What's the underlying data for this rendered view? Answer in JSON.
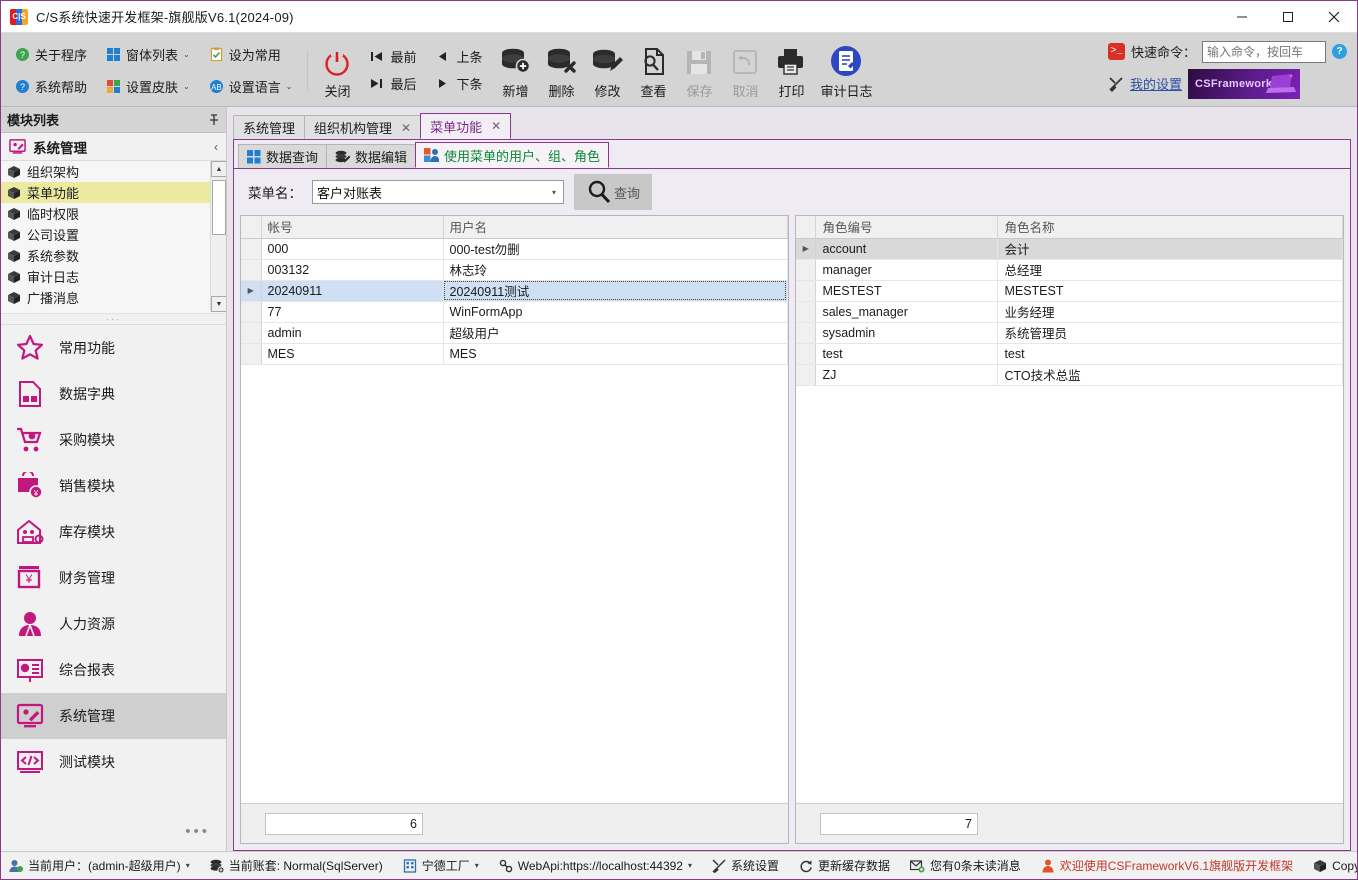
{
  "window": {
    "title": "C/S系统快速开发框架-旗舰版V6.1(2024-09)",
    "logo_text": "C|S",
    "minimize": "—",
    "maximize": "□",
    "close": "✕"
  },
  "ribbon": {
    "small_items": [
      {
        "label": "关于程序",
        "icon": "help-green-icon",
        "caret": ""
      },
      {
        "label": "系统帮助",
        "icon": "help-blue-icon",
        "caret": ""
      },
      {
        "label": "窗体列表",
        "icon": "windows-tile-icon",
        "caret": "⌄"
      },
      {
        "label": "设置皮肤",
        "icon": "skin-palette-icon",
        "caret": "⌄"
      },
      {
        "label": "设为常用",
        "icon": "checklist-icon",
        "caret": ""
      },
      {
        "label": "设置语言",
        "icon": "language-ab-icon",
        "caret": "⌄"
      }
    ],
    "close_button": {
      "label": "关闭",
      "icon": "power-icon"
    },
    "nav": [
      {
        "label": "最前",
        "icon": "first-record-icon"
      },
      {
        "label": "最后",
        "icon": "last-record-icon"
      },
      {
        "label": "上条",
        "icon": "prev-record-icon"
      },
      {
        "label": "下条",
        "icon": "next-record-icon"
      }
    ],
    "big_buttons": [
      {
        "label": "新增",
        "icon": "db-add-icon",
        "disabled": false
      },
      {
        "label": "删除",
        "icon": "db-delete-icon",
        "disabled": false
      },
      {
        "label": "修改",
        "icon": "db-edit-icon",
        "disabled": false
      },
      {
        "label": "查看",
        "icon": "db-view-icon",
        "disabled": false
      },
      {
        "label": "保存",
        "icon": "save-icon",
        "disabled": true
      },
      {
        "label": "取消",
        "icon": "undo-icon",
        "disabled": true
      },
      {
        "label": "打印",
        "icon": "print-icon",
        "disabled": false
      },
      {
        "label": "审计日志",
        "icon": "audit-log-icon",
        "disabled": false
      }
    ],
    "quick_command": {
      "label": "快速命令：",
      "placeholder": "输入命令，按回车",
      "value": "",
      "icon": "console-icon",
      "help": "?"
    },
    "my_settings": {
      "label": "我的设置",
      "icon": "tools-icon"
    },
    "brand": {
      "text": "CSFramework",
      "icon": "laptop-icon"
    }
  },
  "sidebar": {
    "header": {
      "title": "模块列表",
      "pin_icon": "pin-icon"
    },
    "group": {
      "title": "系统管理",
      "icon": "system-manage-icon",
      "collapse_icon": "‹"
    },
    "tree_items": [
      {
        "label": "组织架构",
        "selected": false
      },
      {
        "label": "菜单功能",
        "selected": true
      },
      {
        "label": "临时权限",
        "selected": false
      },
      {
        "label": "公司设置",
        "selected": false
      },
      {
        "label": "系统参数",
        "selected": false
      },
      {
        "label": "审计日志",
        "selected": false
      },
      {
        "label": "广播消息",
        "selected": false
      }
    ],
    "tree_dots": "···",
    "modules": [
      {
        "label": "常用功能",
        "icon": "star-icon",
        "active": false
      },
      {
        "label": "数据字典",
        "icon": "dictionary-icon",
        "active": false
      },
      {
        "label": "采购模块",
        "icon": "cart-icon",
        "active": false
      },
      {
        "label": "销售模块",
        "icon": "sales-bag-icon",
        "active": false
      },
      {
        "label": "库存模块",
        "icon": "warehouse-icon",
        "active": false
      },
      {
        "label": "财务管理",
        "icon": "finance-yen-icon",
        "active": false
      },
      {
        "label": "人力资源",
        "icon": "person-icon",
        "active": false
      },
      {
        "label": "综合报表",
        "icon": "report-chart-icon",
        "active": false
      },
      {
        "label": "系统管理",
        "icon": "system-manage-icon",
        "active": true
      },
      {
        "label": "测试模块",
        "icon": "code-icon",
        "active": false
      }
    ],
    "footer_dots": "•••"
  },
  "main": {
    "doc_tabs": [
      {
        "label": "系统管理",
        "closable": false,
        "active": false
      },
      {
        "label": "组织机构管理",
        "closable": true,
        "active": false
      },
      {
        "label": "菜单功能",
        "closable": true,
        "active": true
      }
    ],
    "sub_tabs": [
      {
        "label": "数据查询",
        "icon": "windows-tile-icon",
        "active": false
      },
      {
        "label": "数据编辑",
        "icon": "edit-stack-icon",
        "active": false
      },
      {
        "label": "使用菜单的用户、组、角色",
        "icon": "users-icon",
        "active": true
      }
    ],
    "filter": {
      "label": "菜单名：",
      "combo_value": "客户对账表",
      "combo_caret": "▾",
      "query_button": {
        "label": "查询",
        "icon": "search-icon"
      }
    },
    "left_grid": {
      "columns": [
        "帐号",
        "用户名"
      ],
      "rows": [
        {
          "indicator": "",
          "cells": [
            "000",
            "000-test勿删"
          ],
          "selected": false
        },
        {
          "indicator": "",
          "cells": [
            "003132",
            "林志玲"
          ],
          "selected": false
        },
        {
          "indicator": "▶",
          "cells": [
            "20240911",
            "20240911测试"
          ],
          "selected": true
        },
        {
          "indicator": "",
          "cells": [
            "77",
            "WinFormApp"
          ],
          "selected": false
        },
        {
          "indicator": "",
          "cells": [
            "admin",
            "超级用户"
          ],
          "selected": false
        },
        {
          "indicator": "",
          "cells": [
            "MES",
            "MES"
          ],
          "selected": false
        }
      ],
      "summary": "6"
    },
    "right_grid": {
      "columns": [
        "角色编号",
        "角色名称"
      ],
      "rows": [
        {
          "indicator": "▶",
          "cells": [
            "account",
            "会计"
          ],
          "selected": true
        },
        {
          "indicator": "",
          "cells": [
            "manager",
            "总经理"
          ],
          "selected": false
        },
        {
          "indicator": "",
          "cells": [
            "MESTEST",
            "MESTEST"
          ],
          "selected": false
        },
        {
          "indicator": "",
          "cells": [
            "sales_manager",
            "业务经理"
          ],
          "selected": false
        },
        {
          "indicator": "",
          "cells": [
            "sysadmin",
            "系统管理员"
          ],
          "selected": false
        },
        {
          "indicator": "",
          "cells": [
            "test",
            "test"
          ],
          "selected": false
        },
        {
          "indicator": "",
          "cells": [
            "ZJ",
            "CTO技术总监"
          ],
          "selected": false
        }
      ],
      "summary": "7"
    }
  },
  "statusbar": {
    "items": [
      {
        "label": "当前用户：(admin-超级用户)",
        "icon": "user-gear-icon",
        "caret": "▾",
        "red": false
      },
      {
        "label": "当前账套: Normal(SqlServer)",
        "icon": "db-user-icon",
        "caret": "",
        "red": false
      },
      {
        "label": "宁德工厂",
        "icon": "building-icon",
        "caret": "▾",
        "red": false
      },
      {
        "label": "WebApi:https://localhost:44392",
        "icon": "link-icon",
        "caret": "▾",
        "red": false
      },
      {
        "label": "系统设置",
        "icon": "tools-icon",
        "caret": "",
        "red": false
      },
      {
        "label": "更新缓存数据",
        "icon": "refresh-icon",
        "caret": "",
        "red": false
      },
      {
        "label": "您有0条未读消息",
        "icon": "mail-add-icon",
        "caret": "",
        "red": false
      },
      {
        "label": "欢迎使用CSFrameworkV6.1旗舰版开发框架",
        "icon": "announce-icon",
        "caret": "",
        "red": true
      },
      {
        "label": "Copy",
        "icon": "cube-icon",
        "caret": "",
        "red": false
      }
    ]
  },
  "colors": {
    "accent_purple": "#8b3a8b",
    "brand_pink": "#c2187e",
    "selected_row": "#cfe0f5",
    "tree_selected": "#ece9a0",
    "status_red": "#c0392b",
    "panel_bg": "#e9e4eb"
  }
}
